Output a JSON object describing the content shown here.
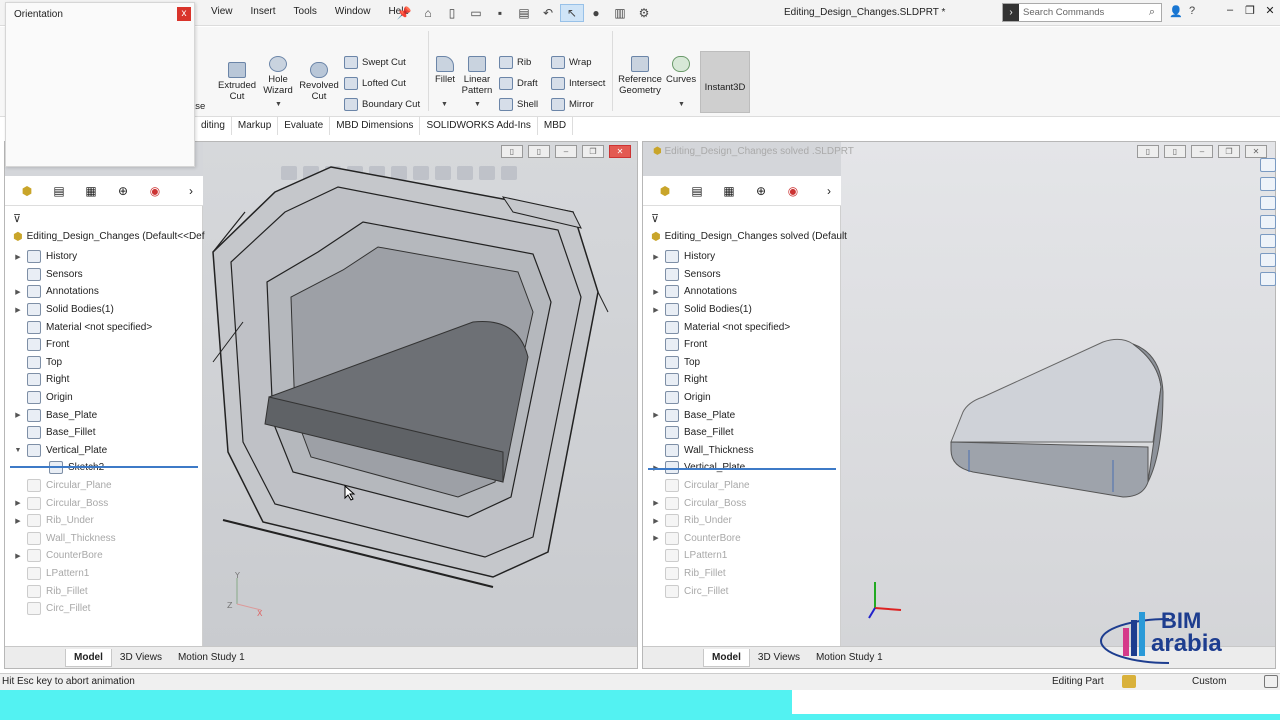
{
  "menu": [
    "View",
    "Insert",
    "Tools",
    "Window",
    "Help"
  ],
  "document_title": "Editing_Design_Changes.SLDPRT *",
  "search": {
    "placeholder": "Search Commands"
  },
  "orientation": {
    "title": "Orientation",
    "close": "x"
  },
  "ribbon": {
    "extruded_cut": "Extruded Cut",
    "hole_wizard": "Hole Wizard",
    "revolved_cut": "Revolved Cut",
    "swept_cut": "Swept Cut",
    "lofted_cut": "Lofted Cut",
    "boundary_cut": "Boundary Cut",
    "fillet": "Fillet",
    "linear_pattern": "Linear Pattern",
    "rib": "Rib",
    "draft": "Draft",
    "shell": "Shell",
    "wrap": "Wrap",
    "intersect": "Intersect",
    "mirror": "Mirror",
    "reference_geometry": "Reference Geometry",
    "curves": "Curves",
    "instant3d": "Instant3D",
    "partial_left_label": "ase"
  },
  "command_tabs": [
    "diting",
    "Markup",
    "Evaluate",
    "MBD Dimensions",
    "SOLIDWORKS Add-Ins",
    "MBD"
  ],
  "left_pane": {
    "root": "Editing_Design_Changes  (Default<<Def",
    "items": [
      {
        "label": "History",
        "arrow": "▶",
        "sup": false
      },
      {
        "label": "Sensors",
        "arrow": "",
        "sup": false
      },
      {
        "label": "Annotations",
        "arrow": "▶",
        "sup": false
      },
      {
        "label": "Solid Bodies(1)",
        "arrow": "▶",
        "sup": false
      },
      {
        "label": "Material <not specified>",
        "arrow": "",
        "sup": false
      },
      {
        "label": "Front",
        "arrow": "",
        "sup": false
      },
      {
        "label": "Top",
        "arrow": "",
        "sup": false
      },
      {
        "label": "Right",
        "arrow": "",
        "sup": false
      },
      {
        "label": "Origin",
        "arrow": "",
        "sup": false
      },
      {
        "label": "Base_Plate",
        "arrow": "▶",
        "sup": false
      },
      {
        "label": "Base_Fillet",
        "arrow": "",
        "sup": false
      },
      {
        "label": "Vertical_Plate",
        "arrow": "▼",
        "sup": false
      },
      {
        "label": "Sketch2",
        "arrow": "",
        "sup": false,
        "child": true
      },
      {
        "label": "Circular_Plane",
        "arrow": "",
        "sup": true
      },
      {
        "label": "Circular_Boss",
        "arrow": "▶",
        "sup": true
      },
      {
        "label": "Rib_Under",
        "arrow": "▶",
        "sup": true
      },
      {
        "label": "Wall_Thickness",
        "arrow": "",
        "sup": true
      },
      {
        "label": "CounterBore",
        "arrow": "▶",
        "sup": true
      },
      {
        "label": "LPattern1",
        "arrow": "",
        "sup": true
      },
      {
        "label": "Rib_Fillet",
        "arrow": "",
        "sup": true
      },
      {
        "label": "Circ_Fillet",
        "arrow": "",
        "sup": true
      }
    ]
  },
  "right_pane": {
    "title": "Editing_Design_Changes solved .SLDPRT",
    "root": "Editing_Design_Changes solved  (Default",
    "items": [
      {
        "label": "History",
        "arrow": "▶",
        "sup": false
      },
      {
        "label": "Sensors",
        "arrow": "",
        "sup": false
      },
      {
        "label": "Annotations",
        "arrow": "▶",
        "sup": false
      },
      {
        "label": "Solid Bodies(1)",
        "arrow": "▶",
        "sup": false
      },
      {
        "label": "Material <not specified>",
        "arrow": "",
        "sup": false
      },
      {
        "label": "Front",
        "arrow": "",
        "sup": false
      },
      {
        "label": "Top",
        "arrow": "",
        "sup": false
      },
      {
        "label": "Right",
        "arrow": "",
        "sup": false
      },
      {
        "label": "Origin",
        "arrow": "",
        "sup": false
      },
      {
        "label": "Base_Plate",
        "arrow": "▶",
        "sup": false
      },
      {
        "label": "Base_Fillet",
        "arrow": "",
        "sup": false
      },
      {
        "label": "Wall_Thickness",
        "arrow": "",
        "sup": false
      },
      {
        "label": "Vertical_Plate",
        "arrow": "▶",
        "sup": false
      },
      {
        "label": "Circular_Plane",
        "arrow": "",
        "sup": true
      },
      {
        "label": "Circular_Boss",
        "arrow": "▶",
        "sup": true
      },
      {
        "label": "Rib_Under",
        "arrow": "▶",
        "sup": true
      },
      {
        "label": "CounterBore",
        "arrow": "▶",
        "sup": true
      },
      {
        "label": "LPattern1",
        "arrow": "",
        "sup": true
      },
      {
        "label": "Rib_Fillet",
        "arrow": "",
        "sup": true
      },
      {
        "label": "Circ_Fillet",
        "arrow": "",
        "sup": true
      }
    ]
  },
  "bottom_tabs": [
    "Model",
    "3D Views",
    "Motion Study 1"
  ],
  "status": {
    "message": "Hit Esc key to abort animation",
    "mode": "Editing Part",
    "units": "Custom"
  },
  "logo": {
    "line1": "BIM",
    "line2": "arabia"
  },
  "colors": {
    "accent": "#3d7ac7",
    "brand": "#1d3d8f",
    "close": "#d9342b"
  }
}
